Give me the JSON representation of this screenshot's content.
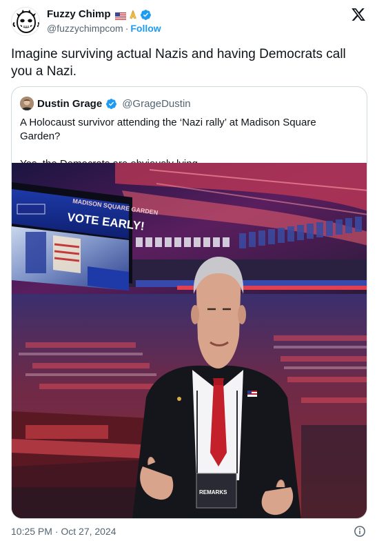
{
  "author": {
    "display_name": "Fuzzy Chimp",
    "handle": "@fuzzychimpcom",
    "separator": "·",
    "follow_label": "Follow",
    "badges": [
      "us-flag-icon",
      "praying-hands-icon",
      "verified-badge-icon"
    ]
  },
  "tweet": {
    "text": "Imagine surviving actual Nazis and having Democrats call you a Nazi.",
    "timestamp": "10:25 PM · Oct 27, 2024"
  },
  "quoted": {
    "display_name": "Dustin Grage",
    "handle": "@GrageDustin",
    "text_line1": "A Holocaust survivor attending the ‘Nazi rally’ at Madison Square Garden?",
    "text_line2": "Yes, the Democrats are obviously lying.",
    "photo": {
      "board_text": "VOTE EARLY!",
      "arena_text": "MADISON SQUARE GARDEN",
      "credential_text": "REMARKS"
    }
  },
  "colors": {
    "accent": "#1d9bf0",
    "text_primary": "#0f1419",
    "text_secondary": "#536471",
    "border": "#cfd9de"
  }
}
